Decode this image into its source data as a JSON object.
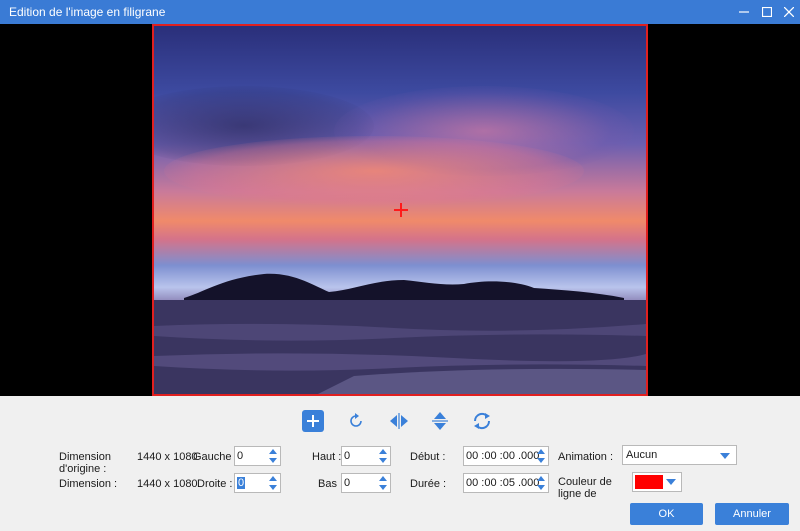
{
  "window": {
    "title": "Edition de l'image en filigrane",
    "accent_color": "#3a80d9",
    "controls": [
      "minimize-icon",
      "maximize-icon",
      "close-icon"
    ]
  },
  "preview": {
    "frame_color": "#e02020",
    "crosshair_color": "#ff1a1a"
  },
  "toolbar": {
    "tools": [
      "add-icon",
      "rotate-icon",
      "flip-horizontal-icon",
      "flip-vertical-icon",
      "reset-icon"
    ]
  },
  "form": {
    "original_dimension_label": "Dimension d'origine :",
    "original_dimension_value": "1440 x 1080",
    "dimension_label": "Dimension :",
    "dimension_value": "1440 x 1080",
    "left_label": "Gauche :",
    "left_value": "0",
    "right_label": "Droite :",
    "right_value": "0",
    "top_label": "Haut :",
    "top_value": "0",
    "bottom_label": "Bas :",
    "bottom_value": "0",
    "start_label": "Début :",
    "start_value": "00 :00 :00 .000",
    "duration_label": "Durée :",
    "duration_value": "00 :00 :05 .000",
    "animation_label": "Animation :",
    "animation_value": "Aucun",
    "line_color_label": "Couleur de ligne de",
    "line_color_value": "#ff0000"
  },
  "buttons": {
    "ok": "OK",
    "cancel": "Annuler"
  }
}
